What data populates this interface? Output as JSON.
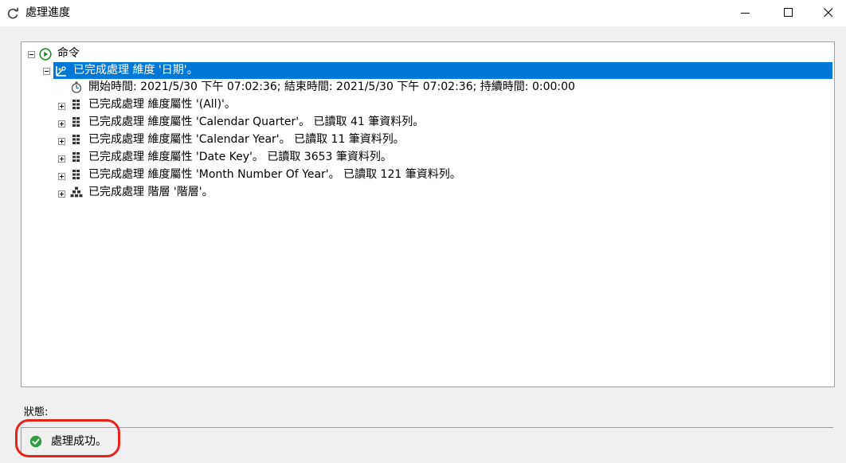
{
  "window": {
    "title": "處理進度"
  },
  "tree": {
    "root": {
      "label": "命令"
    },
    "dimension": {
      "label": "已完成處理 維度 '日期'。",
      "selected": true
    },
    "timing": {
      "label": "開始時間: 2021/5/30 下午 07:02:36; 結束時間: 2021/5/30 下午 07:02:36; 持續時間: 0:00:00"
    },
    "children": [
      {
        "label": "已完成處理 維度屬性 '(All)'。",
        "icon": "attribute-icon"
      },
      {
        "label": "已完成處理 維度屬性 'Calendar Quarter'。 已讀取 41 筆資料列。",
        "icon": "attribute-icon"
      },
      {
        "label": "已完成處理 維度屬性 'Calendar Year'。 已讀取 11 筆資料列。",
        "icon": "attribute-icon"
      },
      {
        "label": "已完成處理 維度屬性 'Date Key'。 已讀取 3653 筆資料列。",
        "icon": "attribute-icon"
      },
      {
        "label": "已完成處理 維度屬性 'Month Number Of Year'。 已讀取 121 筆資料列。",
        "icon": "attribute-icon"
      },
      {
        "label": "已完成處理 階層 '階層'。",
        "icon": "hierarchy-icon"
      }
    ]
  },
  "status": {
    "label": "狀態:",
    "text": "處理成功。",
    "state": "success"
  },
  "colors": {
    "selection": "#0078d7",
    "highlight_ring": "#e8231d",
    "success": "#2e9e3e"
  }
}
